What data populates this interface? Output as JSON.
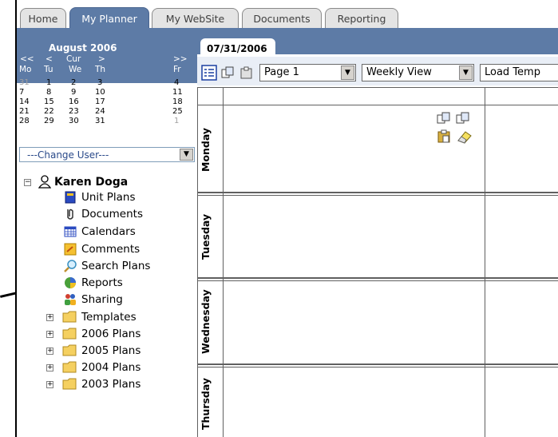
{
  "tabs": [
    "Home",
    "My Planner",
    "My WebSite",
    "Documents",
    "Reporting"
  ],
  "calendar": {
    "month_title": "August 2006",
    "nav": [
      "<<",
      "<",
      "Cur",
      ">",
      ">>"
    ],
    "dow": [
      "Mo",
      "Tu",
      "We",
      "Th",
      "Fr"
    ],
    "weeks": [
      [
        "31",
        "1",
        "2",
        "3",
        "4"
      ],
      [
        "7",
        "8",
        "9",
        "10",
        "11"
      ],
      [
        "14",
        "15",
        "16",
        "17",
        "18"
      ],
      [
        "21",
        "22",
        "23",
        "24",
        "25"
      ],
      [
        "28",
        "29",
        "30",
        "31",
        "1"
      ]
    ]
  },
  "change_user": "---Change User---",
  "tree": {
    "user": "Karen Doga",
    "items": [
      "Unit Plans",
      "Documents",
      "Calendars",
      "Comments",
      "Search Plans",
      "Reports",
      "Sharing"
    ],
    "folders": [
      "Templates",
      "2006 Plans",
      "2005 Plans",
      "2004 Plans",
      "2003 Plans"
    ]
  },
  "planner": {
    "date_tab": "07/31/2006",
    "page_select": "Page 1",
    "view_select": "Weekly View",
    "template_select": "Load Temp",
    "days": [
      "Monday",
      "Tuesday",
      "Wednesday",
      "Thursday"
    ]
  },
  "colors": {
    "accent": "#5d7ba6",
    "toolbar_bg": "#e9eef6"
  },
  "icons": {
    "unit_plans": "book-icon",
    "documents": "paperclip-icon",
    "calendars": "calendar-icon",
    "comments": "note-icon",
    "search_plans": "magnifier-icon",
    "reports": "pie-chart-icon",
    "sharing": "people-icon",
    "folder": "folder-icon",
    "user": "user-icon"
  }
}
